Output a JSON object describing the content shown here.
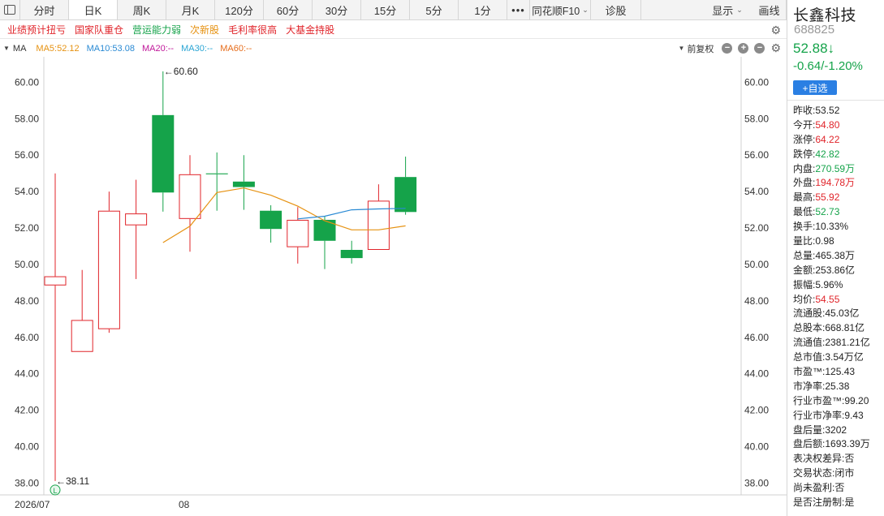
{
  "topbar": {
    "tabs": [
      "分时",
      "日K",
      "周K",
      "月K",
      "120分",
      "60分",
      "30分",
      "15分",
      "5分",
      "1分"
    ],
    "active_tab": "日K",
    "more_label": "•••",
    "f10_label": "同花顺F10",
    "diag_label": "诊股",
    "show_label": "显示",
    "draw_label": "画线"
  },
  "tags": [
    {
      "label": "业绩预计扭亏",
      "color": "#e0242a"
    },
    {
      "label": "国家队重仓",
      "color": "#e0242a"
    },
    {
      "label": "营运能力弱",
      "color": "#15a34a"
    },
    {
      "label": "次新股",
      "color": "#e69212"
    },
    {
      "label": "毛利率很高",
      "color": "#e0242a"
    },
    {
      "label": "大基金持股",
      "color": "#e0242a"
    }
  ],
  "ma_bar": {
    "name": "MA",
    "items": [
      {
        "label": "MA5:52.12",
        "color": "#e69212"
      },
      {
        "label": "MA10:53.08",
        "color": "#2a8ad4"
      },
      {
        "label": "MA20:--",
        "color": "#c0189a"
      },
      {
        "label": "MA30:--",
        "color": "#2aa5d4"
      },
      {
        "label": "MA60:--",
        "color": "#e66c1a"
      }
    ],
    "adjust_label": "前复权",
    "zoom_out": "−",
    "zoom_in": "+",
    "zoom_fit": "−"
  },
  "chart_data": {
    "type": "candlestick",
    "x_labels": [
      {
        "label": "2026/07",
        "index": 0
      },
      {
        "label": "08",
        "index": 5
      }
    ],
    "y_ticks": [
      "60.00",
      "58.00",
      "56.00",
      "54.00",
      "52.00",
      "50.00",
      "48.00",
      "46.00",
      "44.00",
      "42.00",
      "40.00",
      "38.00"
    ],
    "ylim": [
      37.35,
      61.4
    ],
    "candles": [
      {
        "o": 48.85,
        "h": 55.0,
        "l": 38.11,
        "c": 49.35
      },
      {
        "o": 45.2,
        "h": 49.7,
        "l": 45.2,
        "c": 46.95
      },
      {
        "o": 46.45,
        "h": 54.0,
        "l": 46.25,
        "c": 52.95
      },
      {
        "o": 52.15,
        "h": 54.65,
        "l": 49.2,
        "c": 52.8
      },
      {
        "o": 58.2,
        "h": 60.6,
        "l": 52.9,
        "c": 53.95
      },
      {
        "o": 52.5,
        "h": 56.0,
        "l": 50.7,
        "c": 54.95
      },
      {
        "o": 55.0,
        "h": 56.15,
        "l": 52.95,
        "c": 54.95
      },
      {
        "o": 54.55,
        "h": 56.0,
        "l": 53.0,
        "c": 54.25
      },
      {
        "o": 52.95,
        "h": 53.25,
        "l": 51.2,
        "c": 51.95
      },
      {
        "o": 50.95,
        "h": 53.15,
        "l": 50.05,
        "c": 52.45
      },
      {
        "o": 52.45,
        "h": 52.65,
        "l": 49.75,
        "c": 51.3
      },
      {
        "o": 50.8,
        "h": 51.3,
        "l": 50.05,
        "c": 50.35
      },
      {
        "o": 50.8,
        "h": 54.4,
        "l": 50.8,
        "c": 53.5
      },
      {
        "o": 54.8,
        "h": 55.92,
        "l": 52.73,
        "c": 52.88
      }
    ],
    "ma5": [
      null,
      null,
      null,
      null,
      51.2,
      52.1,
      53.95,
      54.2,
      53.8,
      53.2,
      52.4,
      51.9,
      51.9,
      52.12
    ],
    "ma10": [
      null,
      null,
      null,
      null,
      null,
      null,
      null,
      null,
      null,
      52.5,
      52.65,
      53.0,
      53.05,
      53.08
    ],
    "ma5_color": "#e69212",
    "ma10_color": "#2a8ad4",
    "up_color": "#e0242a",
    "down_color": "#15a34a",
    "max_label": "←60.60",
    "max_index": 4,
    "max_value": 60.6,
    "min_label": "←38.11",
    "min_index": 0,
    "min_value": 38.11,
    "marker_label": "L",
    "grid": false
  },
  "side": {
    "name": "长鑫科技",
    "code": "688825",
    "price": "52.88↓",
    "change": "-0.64/-1.20%",
    "add_label": "+自选",
    "rows": [
      {
        "k": "昨收:",
        "v": "53.52",
        "c": ""
      },
      {
        "k": "今开:",
        "v": "54.80",
        "c": "red"
      },
      {
        "k": "涨停:",
        "v": "64.22",
        "c": "red"
      },
      {
        "k": "跌停:",
        "v": "42.82",
        "c": "green"
      },
      {
        "k": "内盘:",
        "v": "270.59万",
        "c": "green"
      },
      {
        "k": "外盘:",
        "v": "194.78万",
        "c": "red"
      },
      {
        "k": "最高:",
        "v": "55.92",
        "c": "red"
      },
      {
        "k": "最低:",
        "v": "52.73",
        "c": "green"
      },
      {
        "k": "换手:",
        "v": "10.33%",
        "c": ""
      },
      {
        "k": "量比:",
        "v": "0.98",
        "c": ""
      },
      {
        "k": "总量:",
        "v": "465.38万",
        "c": ""
      },
      {
        "k": "金额:",
        "v": "253.86亿",
        "c": ""
      },
      {
        "k": "振幅:",
        "v": "5.96%",
        "c": ""
      },
      {
        "k": "均价:",
        "v": "54.55",
        "c": "red"
      },
      {
        "k": "流通股:",
        "v": "45.03亿",
        "c": ""
      },
      {
        "k": "总股本:",
        "v": "668.81亿",
        "c": ""
      },
      {
        "k": "流通值:",
        "v": "2381.21亿",
        "c": ""
      },
      {
        "k": "总市值:",
        "v": "3.54万亿",
        "c": ""
      },
      {
        "k": "市盈™:",
        "v": "125.43",
        "c": ""
      },
      {
        "k": "市净率:",
        "v": "25.38",
        "c": ""
      },
      {
        "k": "行业市盈™:",
        "v": "99.20",
        "c": ""
      },
      {
        "k": "行业市净率:",
        "v": "9.43",
        "c": ""
      },
      {
        "k": "盘后量:",
        "v": "3202",
        "c": ""
      },
      {
        "k": "盘后额:",
        "v": "1693.39万",
        "c": ""
      },
      {
        "k": "表决权差异:",
        "v": "否",
        "c": ""
      },
      {
        "k": "交易状态:",
        "v": "闭市",
        "c": ""
      },
      {
        "k": "尚未盈利:",
        "v": "否",
        "c": ""
      },
      {
        "k": "是否注册制:",
        "v": "是",
        "c": ""
      }
    ]
  }
}
